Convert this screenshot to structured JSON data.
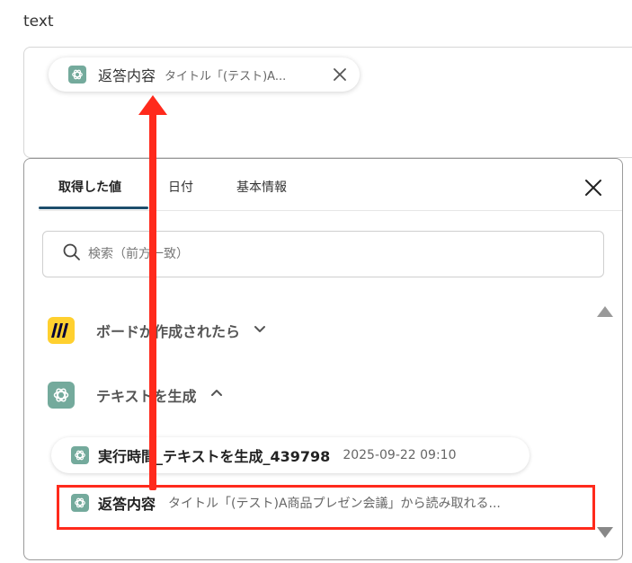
{
  "field": {
    "label": "text"
  },
  "chip": {
    "title": "返答内容",
    "subtitle": "タイトル「(テスト)A..."
  },
  "panel": {
    "tabs": [
      {
        "label": "取得した値"
      },
      {
        "label": "日付"
      },
      {
        "label": "基本情報"
      }
    ],
    "search": {
      "placeholder": "検索（前方一致）",
      "value": ""
    },
    "sections": [
      {
        "label": "ボードが作成されたら",
        "icon": "miro-icon",
        "expanded": false
      },
      {
        "label": "テキストを生成",
        "icon": "chatgpt-icon",
        "expanded": true
      }
    ],
    "items": [
      {
        "title": "実行時間_テキストを生成_439798",
        "subtitle": "2025-09-22 09:10"
      },
      {
        "title": "返答内容",
        "subtitle": "タイトル「(テスト)A商品プレゼン会議」から読み取れる..."
      }
    ]
  },
  "colors": {
    "annotation": "#ff2a1c",
    "tab_underline": "#1d4e6c",
    "chatgpt": "#74aa9c",
    "miro": "#ffd02f"
  }
}
